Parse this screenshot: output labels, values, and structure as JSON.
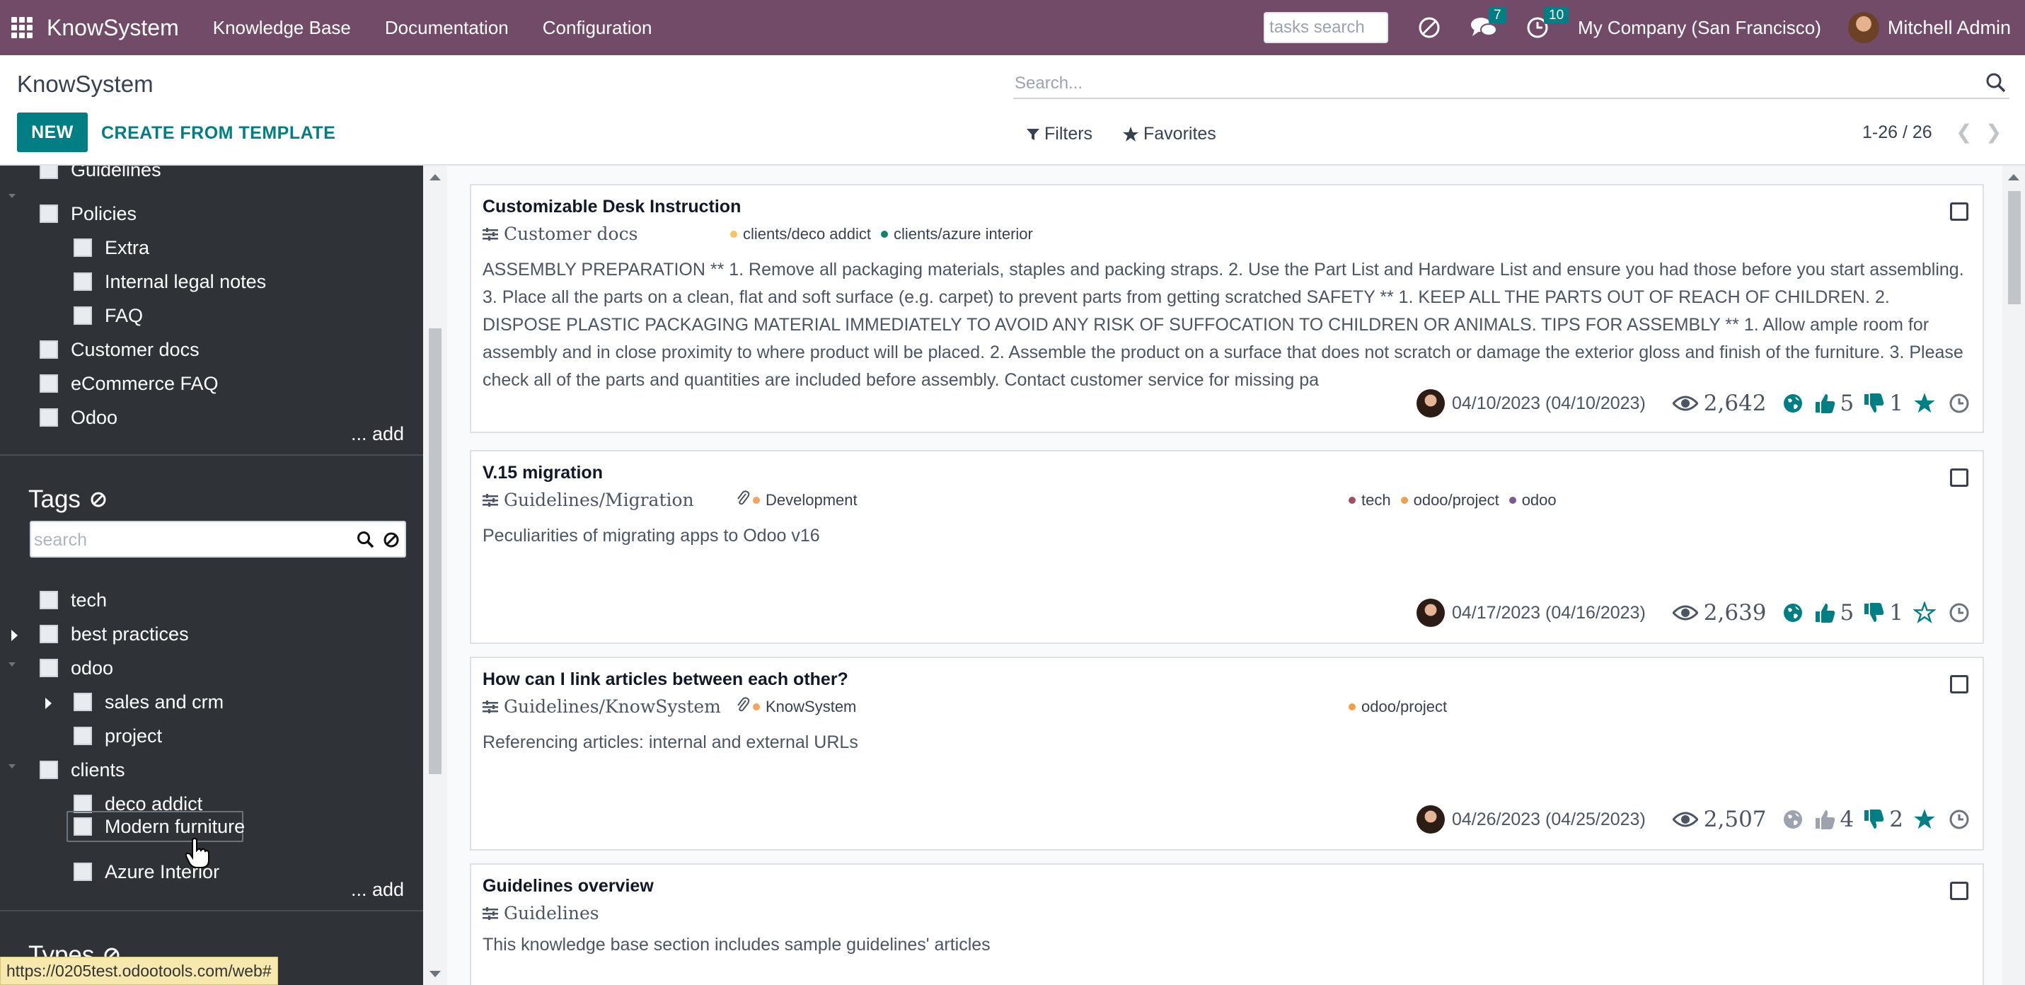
{
  "navbar": {
    "brand": "KnowSystem",
    "menu": [
      "Knowledge Base",
      "Documentation",
      "Configuration"
    ],
    "tasks_search_placeholder": "tasks search",
    "messages_badge": "7",
    "activities_badge": "10",
    "company": "My Company (San Francisco)",
    "user": "Mitchell Admin"
  },
  "control_panel": {
    "title": "KnowSystem",
    "new_label": "NEW",
    "template_label": "CREATE FROM TEMPLATE",
    "search_placeholder": "Search...",
    "filters_label": "Filters",
    "favorites_label": "Favorites",
    "pager": "1-26 / 26"
  },
  "sidebar": {
    "sections": {
      "items": [
        "Guidelines",
        "Policies",
        "Extra",
        "Internal legal notes",
        "FAQ",
        "Customer docs",
        "eCommerce FAQ",
        "Odoo"
      ],
      "add_label": "... add"
    },
    "tags": {
      "title": "Tags",
      "search_placeholder": "search",
      "items": [
        "tech",
        "best practices",
        "odoo",
        "sales and crm",
        "project",
        "clients",
        "deco addict",
        "Modern furniture",
        "Azure Interior"
      ],
      "add_label": "... add"
    },
    "types": {
      "title": "Types"
    }
  },
  "articles": [
    {
      "title": "Customizable Desk Instruction",
      "section": "Customer docs",
      "tags_left": [
        {
          "label": "clients/deco addict",
          "color": "#f4c36a"
        },
        {
          "label": "clients/azure interior",
          "color": "#12826f"
        }
      ],
      "tags_right": [],
      "description": "ASSEMBLY PREPARATION ** 1. Remove all packaging materials, staples and packing straps. 2. Use the Part List and Hardware List and ensure you had those before you start assembling. 3. Place all the parts on a clean, flat and soft surface (e.g. carpet) to prevent parts from getting scratched SAFETY ** 1. KEEP ALL THE PARTS OUT OF REACH OF CHILDREN. 2. DISPOSE PLASTIC PACKAGING MATERIAL IMMEDIATELY TO AVOID ANY RISK OF SUFFOCATION TO CHILDREN OR ANIMALS. TIPS FOR ASSEMBLY ** 1. Allow ample room for assembly and in close proximity to where product will be placed. 2. Assemble the product on a surface that does not scratch or damage the exterior gloss and finish of the furniture. 3. Please check all of the parts and quantities are included before assembly. Contact customer service for missing pa",
      "dates": "04/10/2023 (04/10/2023)",
      "views": "2,642",
      "likes": "5",
      "dislikes": "1",
      "favorite": true,
      "published": true,
      "attachment": false
    },
    {
      "title": "V.15 migration",
      "section": "Guidelines/Migration",
      "tags_left": [
        {
          "label": "Development",
          "color": "#f4a460"
        }
      ],
      "tags_right": [
        {
          "label": "tech",
          "color": "#a0505e"
        },
        {
          "label": "odoo/project",
          "color": "#f0a048"
        },
        {
          "label": "odoo",
          "color": "#7a5a8f"
        }
      ],
      "description": "Peculiarities of migrating apps to Odoo v16",
      "dates": "04/17/2023 (04/16/2023)",
      "views": "2,639",
      "likes": "5",
      "dislikes": "1",
      "favorite": false,
      "published": true,
      "attachment": true
    },
    {
      "title": "How can I link articles between each other?",
      "section": "Guidelines/KnowSystem",
      "tags_left": [
        {
          "label": "KnowSystem",
          "color": "#f4a460"
        }
      ],
      "tags_right": [
        {
          "label": "odoo/project",
          "color": "#f0a048"
        }
      ],
      "description": "Referencing articles: internal and external URLs",
      "dates": "04/26/2023 (04/25/2023)",
      "views": "2,507",
      "likes": "4",
      "dislikes": "2",
      "favorite": true,
      "published": false,
      "attachment": true
    },
    {
      "title": "Guidelines overview",
      "section": "Guidelines",
      "tags_left": [],
      "tags_right": [],
      "description": "This knowledge base section includes sample guidelines' articles"
    }
  ],
  "status_url": "https://0205test.odootools.com/web#",
  "colors": {
    "navbar": "#714B67",
    "primary": "#017e84",
    "sidebar_bg": "#2f3338"
  }
}
